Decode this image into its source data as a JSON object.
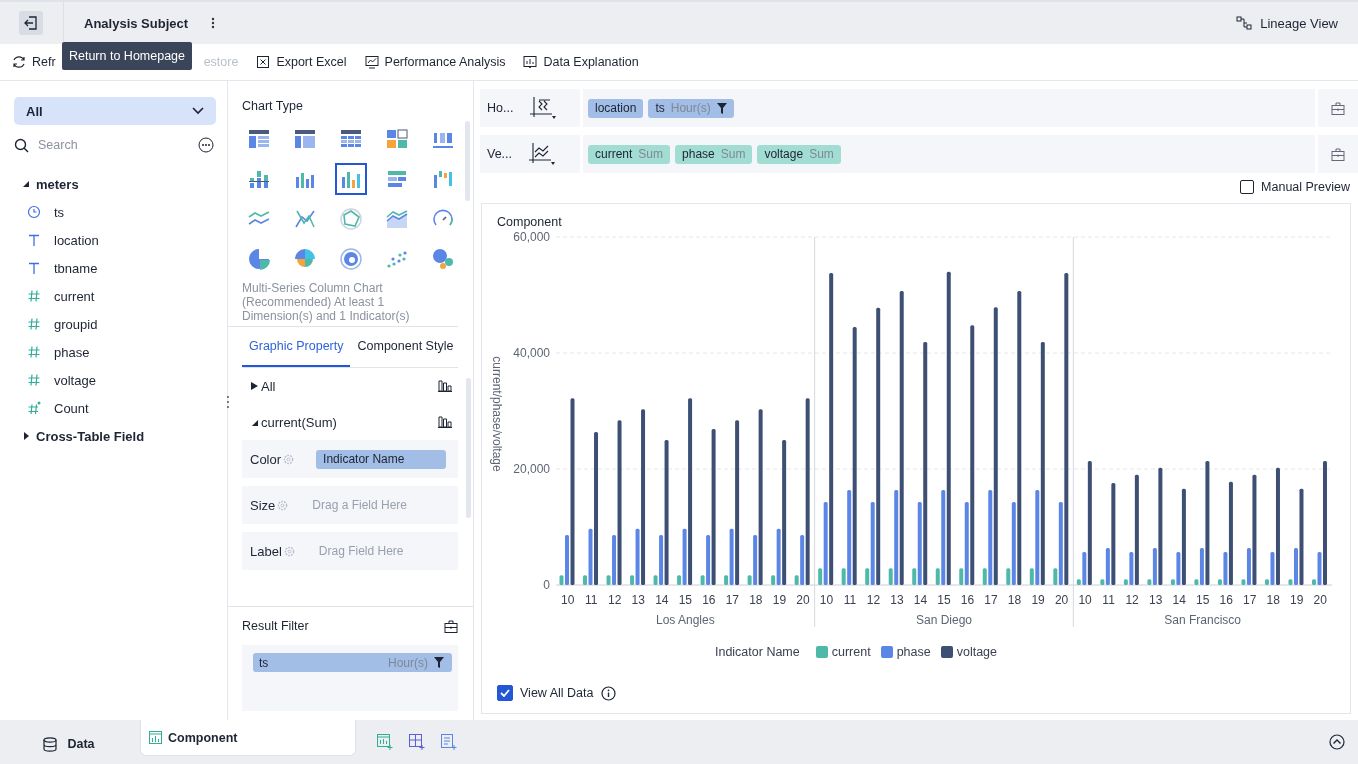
{
  "top_bar": {
    "title": "Analysis Subject",
    "tooltip": "Return to Homepage",
    "lineage_button": "Lineage View"
  },
  "toolbar": [
    {
      "label": "Refr",
      "kind": "refresh",
      "disabled": false
    },
    {
      "label": "estore",
      "kind": "restore",
      "disabled": true
    },
    {
      "label": "Export Excel",
      "kind": "excel",
      "disabled": false
    },
    {
      "label": "Performance Analysis",
      "kind": "performance",
      "disabled": false
    },
    {
      "label": "Data Explanation",
      "kind": "explanation",
      "disabled": false
    }
  ],
  "data_panel": {
    "source": "All",
    "search": {
      "placeholder": "Search"
    },
    "tree": [
      {
        "label": "meters",
        "expanded": true,
        "children": [
          {
            "label": "ts",
            "kind": "time"
          },
          {
            "label": "location",
            "kind": "text"
          },
          {
            "label": "tbname",
            "kind": "text"
          },
          {
            "label": "current",
            "kind": "number"
          },
          {
            "label": "groupid",
            "kind": "number"
          },
          {
            "label": "phase",
            "kind": "number"
          },
          {
            "label": "voltage",
            "kind": "number"
          },
          {
            "label": "Count",
            "kind": "calculated"
          }
        ]
      },
      {
        "label": "Cross-Table Field",
        "expanded": false
      }
    ]
  },
  "chart_panel": {
    "title": "Chart Type",
    "chart_types": [
      {
        "kind": "grouped-table",
        "selected": false
      },
      {
        "kind": "cross-table",
        "selected": false
      },
      {
        "kind": "detail-table",
        "selected": false
      },
      {
        "kind": "kpi-card",
        "selected": false
      },
      {
        "kind": "number",
        "selected": false
      },
      {
        "kind": "stacked-column",
        "selected": false
      },
      {
        "kind": "column",
        "selected": false
      },
      {
        "kind": "multi-column",
        "selected": true
      },
      {
        "kind": "bar",
        "selected": false
      },
      {
        "kind": "waterfall",
        "selected": false
      },
      {
        "kind": "line",
        "selected": false
      },
      {
        "kind": "crossing-line",
        "selected": false
      },
      {
        "kind": "radar",
        "selected": false
      },
      {
        "kind": "area",
        "selected": false
      },
      {
        "kind": "gauge",
        "selected": false
      },
      {
        "kind": "pie",
        "selected": false
      },
      {
        "kind": "rose",
        "selected": false
      },
      {
        "kind": "donut",
        "selected": false
      },
      {
        "kind": "scatter",
        "selected": false
      },
      {
        "kind": "bubble",
        "selected": false
      }
    ],
    "description": "Multi-Series Column Chart (Recommended) At least 1 Dimension(s) and 1 Indicator(s)",
    "tabs": [
      {
        "label": "Graphic Property",
        "selected": true
      },
      {
        "label": "Component Style",
        "selected": false
      }
    ],
    "property_groups": [
      {
        "label": "All",
        "expanded": false
      },
      {
        "label": "current(Sum)",
        "expanded": true
      }
    ],
    "properties": [
      {
        "label": "Color",
        "value": "Indicator Name"
      },
      {
        "label": "Size",
        "placeholder": "Drag a Field Here"
      },
      {
        "label": "Label",
        "placeholder": "Drag Field Here"
      }
    ],
    "result_filter": {
      "title": "Result Filter",
      "fields": [
        {
          "name": "ts",
          "granularity": "Hour(s)",
          "filtered": true
        }
      ]
    }
  },
  "shelves": [
    {
      "label": "Ho...",
      "kind": "horizontal",
      "fields": [
        {
          "name": "location",
          "kind": "dimension",
          "filtered": false
        },
        {
          "name": "ts",
          "aggregation": "Hour(s)",
          "kind": "dimension",
          "filtered": true
        }
      ]
    },
    {
      "label": "Ve...",
      "kind": "vertical",
      "fields": [
        {
          "name": "current",
          "aggregation": "Sum",
          "kind": "indicator",
          "filtered": false
        },
        {
          "name": "phase",
          "aggregation": "Sum",
          "kind": "indicator",
          "filtered": false
        },
        {
          "name": "voltage",
          "aggregation": "Sum",
          "kind": "indicator",
          "filtered": false
        }
      ]
    }
  ],
  "manual_preview": {
    "label": "Manual Preview",
    "checked": false
  },
  "component": {
    "title": "Component",
    "chart_data": {
      "type": "bar",
      "ylabel": "current/phase/voltage",
      "categories": [
        "10",
        "11",
        "12",
        "13",
        "14",
        "15",
        "16",
        "17",
        "18",
        "19",
        "20",
        "10",
        "11",
        "12",
        "13",
        "14",
        "15",
        "16",
        "17",
        "18",
        "19",
        "20",
        "10",
        "11",
        "12",
        "13",
        "14",
        "15",
        "16",
        "17",
        "18",
        "19",
        "20"
      ],
      "series": [
        {
          "name": "current",
          "color": "#4fb9a9",
          "values": [
            1700,
            1700,
            1700,
            1700,
            1700,
            1700,
            1700,
            1700,
            1700,
            1700,
            1700,
            2900,
            2900,
            2900,
            2900,
            2900,
            2900,
            2900,
            2900,
            2900,
            2900,
            2900,
            1000,
            1000,
            1000,
            1000,
            1000,
            1000,
            1000,
            1000,
            1000,
            1000,
            1000
          ]
        },
        {
          "name": "phase",
          "color": "#5b86e5",
          "values": [
            8600,
            9700,
            8600,
            9700,
            8600,
            9700,
            8600,
            9700,
            8600,
            9700,
            8600,
            14300,
            16400,
            14300,
            16400,
            14300,
            16400,
            14300,
            16400,
            14300,
            16400,
            14300,
            5700,
            6400,
            5700,
            6400,
            5700,
            6400,
            5700,
            6400,
            5700,
            6400,
            5700
          ]
        },
        {
          "name": "voltage",
          "color": "#3d4f73",
          "values": [
            32200,
            26400,
            28400,
            30300,
            25000,
            32200,
            26900,
            28400,
            30300,
            25000,
            32200,
            53800,
            44500,
            47800,
            50700,
            41900,
            54000,
            44800,
            47900,
            50700,
            41900,
            53800,
            21400,
            17600,
            19000,
            20200,
            16600,
            21400,
            17800,
            19000,
            20200,
            16600,
            21400
          ]
        }
      ],
      "ylim": [
        0,
        60000
      ],
      "yticks": [
        {
          "value": 0,
          "label": "0"
        },
        {
          "value": 20000,
          "label": "20,000"
        },
        {
          "value": 40000,
          "label": "40,000"
        },
        {
          "value": 60000,
          "label": "60,000"
        }
      ]
    },
    "group_labels": [
      "Los Angles",
      "San Diego",
      "San Francisco"
    ],
    "legend_title": "Indicator Name",
    "view_all_data": {
      "label": "View All Data",
      "checked": true
    }
  },
  "bottom_tabs": [
    {
      "label": "Data",
      "kind": "data",
      "selected": false
    },
    {
      "label": "Component",
      "kind": "component",
      "selected": true
    }
  ]
}
